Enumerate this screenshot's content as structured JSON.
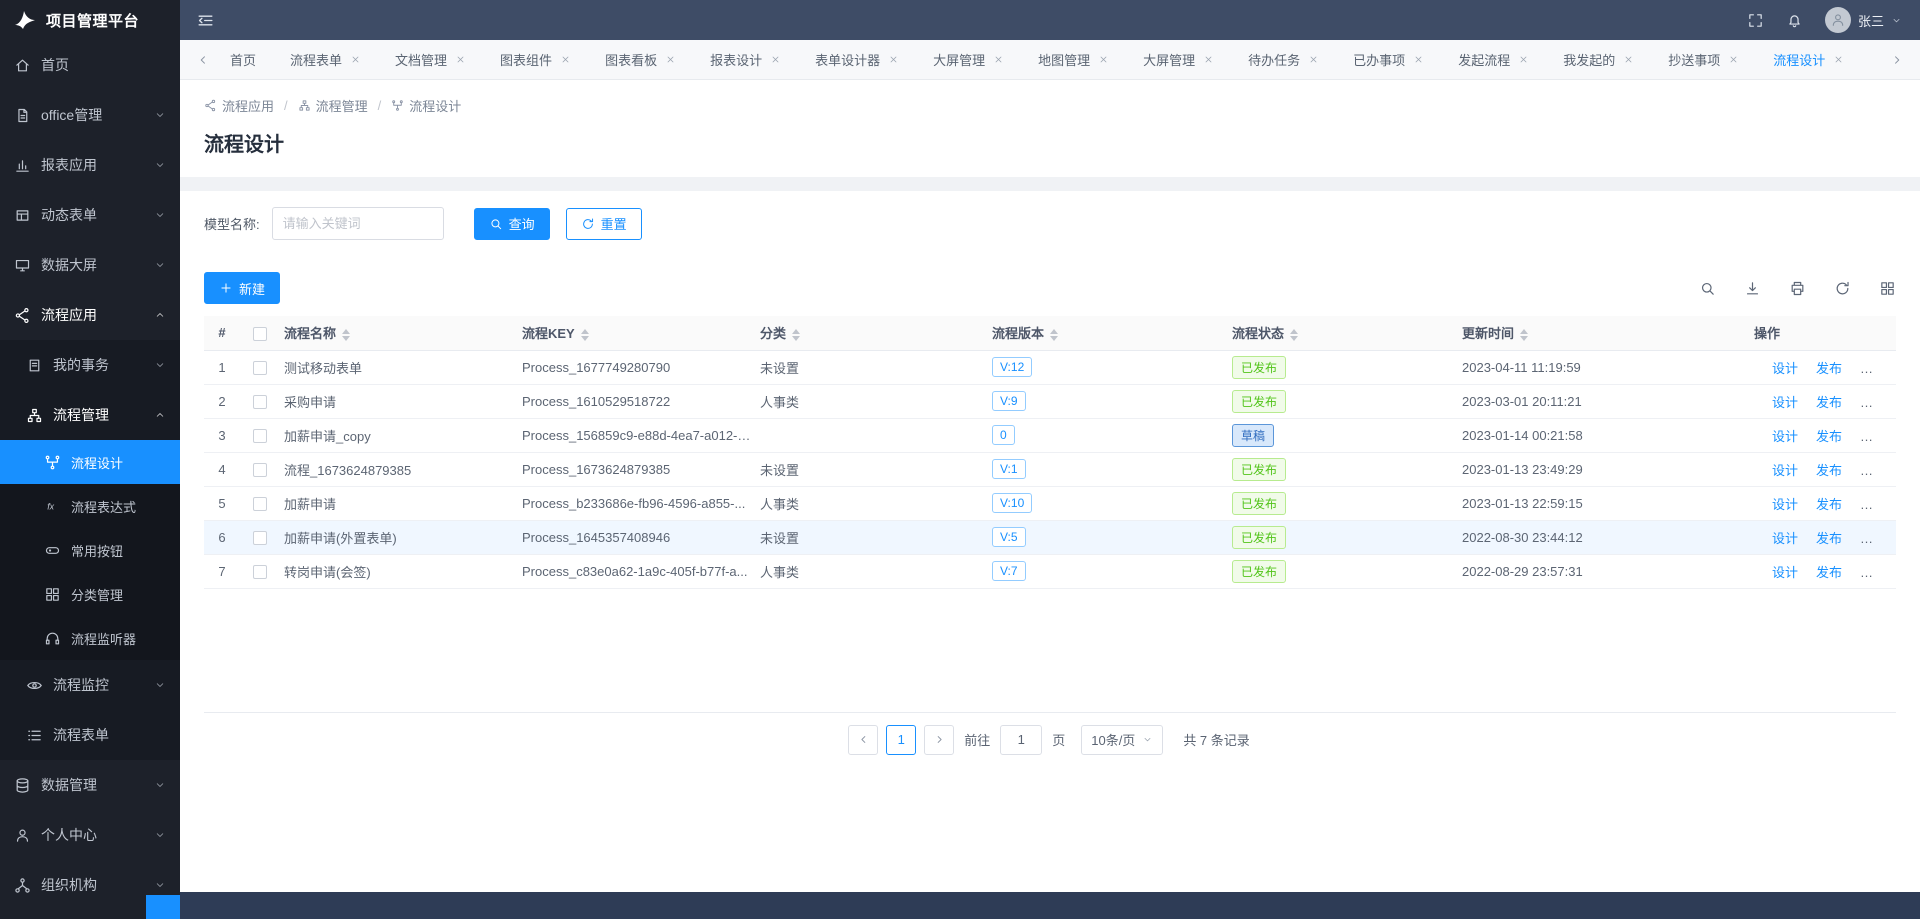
{
  "colors": {
    "accent": "#1890ff",
    "topbar-bg": "#3e4c66",
    "sidebar-bg": "#1d212a",
    "submenu-bg": "#171b23",
    "submenu2-bg": "#13161d",
    "footer-bg": "#2e3c56",
    "success-text": "#52c41a",
    "success-bg": "#f1fbe9",
    "success-border": "#b7eb8f"
  },
  "header": {
    "logo_text": "项目管理平台",
    "user_name": "张三"
  },
  "sidebar": {
    "items": [
      {
        "label": "首页"
      },
      {
        "label": "office管理"
      },
      {
        "label": "报表应用"
      },
      {
        "label": "动态表单"
      },
      {
        "label": "数据大屏"
      },
      {
        "label": "流程应用",
        "expanded": true,
        "children": [
          {
            "label": "我的事务"
          },
          {
            "label": "流程管理",
            "expanded": true,
            "children": [
              {
                "label": "流程设计",
                "active": true
              },
              {
                "label": "流程表达式"
              },
              {
                "label": "常用按钮"
              },
              {
                "label": "分类管理"
              },
              {
                "label": "流程监听器"
              }
            ]
          },
          {
            "label": "流程监控"
          },
          {
            "label": "流程表单"
          }
        ]
      },
      {
        "label": "数据管理"
      },
      {
        "label": "个人中心"
      },
      {
        "label": "组织机构"
      }
    ]
  },
  "tabs": [
    {
      "label": "首页",
      "closable": false
    },
    {
      "label": "流程表单"
    },
    {
      "label": "文档管理"
    },
    {
      "label": "图表组件"
    },
    {
      "label": "图表看板"
    },
    {
      "label": "报表设计"
    },
    {
      "label": "表单设计器"
    },
    {
      "label": "大屏管理"
    },
    {
      "label": "地图管理"
    },
    {
      "label": "大屏管理"
    },
    {
      "label": "待办任务"
    },
    {
      "label": "已办事项"
    },
    {
      "label": "发起流程"
    },
    {
      "label": "我发起的"
    },
    {
      "label": "抄送事项"
    },
    {
      "label": "流程设计",
      "active": true
    }
  ],
  "breadcrumb": [
    "流程应用",
    "流程管理",
    "流程设计"
  ],
  "page": {
    "title": "流程设计"
  },
  "filter": {
    "label": "模型名称:",
    "placeholder": "请输入关键词",
    "search_label": "查询",
    "reset_label": "重置"
  },
  "toolbar": {
    "new_label": "新建"
  },
  "table": {
    "headers": [
      "#",
      "流程名称",
      "流程KEY",
      "分类",
      "流程版本",
      "流程状态",
      "更新时间",
      "操作"
    ],
    "action_labels": [
      "设计",
      "发布",
      "更多"
    ],
    "rows": [
      {
        "index": "1",
        "name": "测试移动表单",
        "key": "Process_1677749280790",
        "category": "未设置",
        "version": "V:12",
        "status": "已发布",
        "updated": "2023-04-11 11:19:59"
      },
      {
        "index": "2",
        "name": "采购申请",
        "key": "Process_1610529518722",
        "category": "人事类",
        "version": "V:9",
        "status": "已发布",
        "updated": "2023-03-01 20:11:21"
      },
      {
        "index": "3",
        "name": "加薪申请_copy",
        "key": "Process_156859c9-e88d-4ea7-a012-c...",
        "category": "",
        "version": "0",
        "status": "草稿",
        "updated": "2023-01-14 00:21:58"
      },
      {
        "index": "4",
        "name": "流程_1673624879385",
        "key": "Process_1673624879385",
        "category": "未设置",
        "version": "V:1",
        "status": "已发布",
        "updated": "2023-01-13 23:49:29"
      },
      {
        "index": "5",
        "name": "加薪申请",
        "key": "Process_b233686e-fb96-4596-a855-...",
        "category": "人事类",
        "version": "V:10",
        "status": "已发布",
        "updated": "2023-01-13 22:59:15"
      },
      {
        "index": "6",
        "name": "加薪申请(外置表单)",
        "key": "Process_1645357408946",
        "category": "未设置",
        "version": "V:5",
        "status": "已发布",
        "updated": "2022-08-30 23:44:12"
      },
      {
        "index": "7",
        "name": "转岗申请(会签)",
        "key": "Process_c83e0a62-1a9c-405f-b77f-a...",
        "category": "人事类",
        "version": "V:7",
        "status": "已发布",
        "updated": "2022-08-29 23:57:31"
      }
    ]
  },
  "pagination": {
    "page": "1",
    "goto_label": "前往",
    "goto_value": "1",
    "page_unit": "页",
    "page_size": "10条/页",
    "total": "共 7 条记录"
  }
}
